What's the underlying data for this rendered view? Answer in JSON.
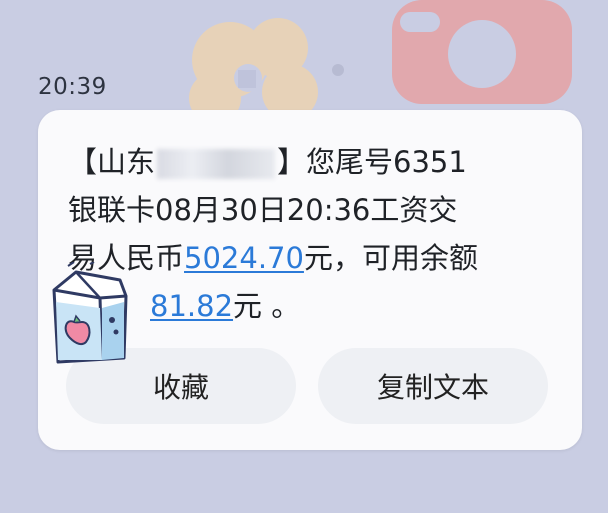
{
  "status": {
    "time": "20:39"
  },
  "message": {
    "bracket_open": "【山东",
    "bracket_close": "】您尾号6351",
    "line2": "银联卡08月30日20:36工资交",
    "line3_prefix": "易人民币",
    "amount": "5024.70",
    "line3_suffix": "元，可用余额",
    "balance_partial": "81.82",
    "line4_suffix": "元 。"
  },
  "actions": {
    "collect_label": "收藏",
    "copy_label": "复制文本"
  },
  "colors": {
    "link": "#2b7ad8",
    "card": "#fafafc",
    "background": "#c9cde3"
  },
  "icons": [
    "milk-carton-sticker-icon"
  ]
}
